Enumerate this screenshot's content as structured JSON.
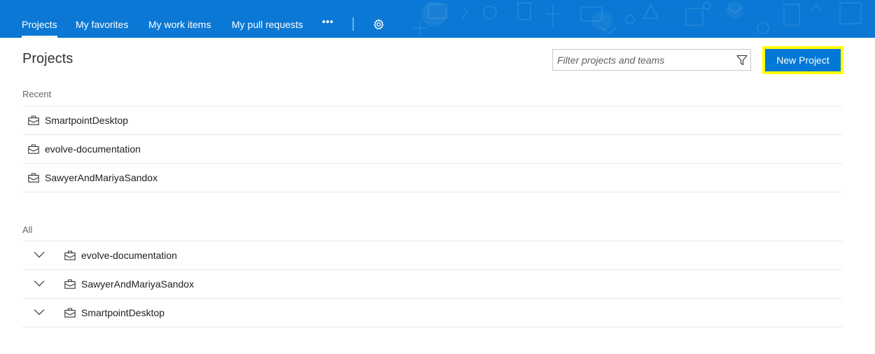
{
  "nav": {
    "items": [
      {
        "label": "Projects",
        "active": true
      },
      {
        "label": "My favorites",
        "active": false
      },
      {
        "label": "My work items",
        "active": false
      },
      {
        "label": "My pull requests",
        "active": false
      }
    ],
    "more_icon": "ellipsis-icon",
    "settings_icon": "gear-icon",
    "background_color": "#0a78d4"
  },
  "page": {
    "title": "Projects"
  },
  "filter": {
    "placeholder": "Filter projects and teams",
    "value": "",
    "icon": "funnel-filter-icon"
  },
  "new_project_button": {
    "label": "New Project",
    "color": "#0078d7",
    "highlight_color": "#ffff00"
  },
  "recent": {
    "label": "Recent",
    "projects": [
      {
        "name": "SmartpointDesktop",
        "icon": "project-briefcase-icon"
      },
      {
        "name": "evolve-documentation",
        "icon": "project-briefcase-icon"
      },
      {
        "name": "SawyerAndMariyaSandox",
        "icon": "project-briefcase-icon"
      }
    ]
  },
  "all": {
    "label": "All",
    "projects": [
      {
        "name": "evolve-documentation",
        "icon": "project-briefcase-icon",
        "expand_icon": "chevron-down-icon"
      },
      {
        "name": "SawyerAndMariyaSandox",
        "icon": "project-briefcase-icon",
        "expand_icon": "chevron-down-icon"
      },
      {
        "name": "SmartpointDesktop",
        "icon": "project-briefcase-icon",
        "expand_icon": "chevron-down-icon"
      }
    ]
  }
}
